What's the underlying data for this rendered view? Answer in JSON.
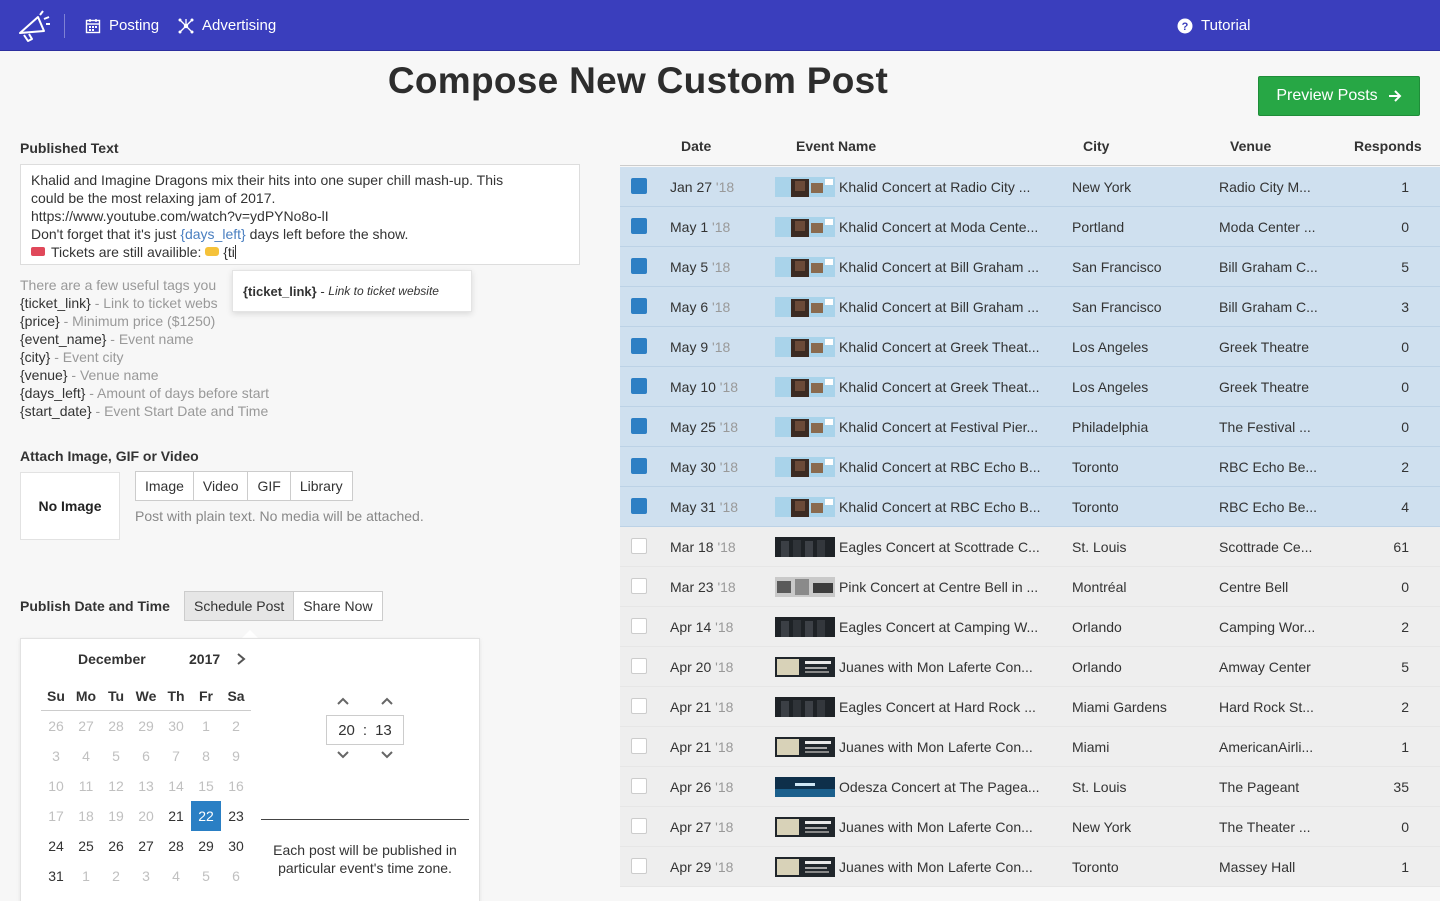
{
  "nav": {
    "posting": "Posting",
    "advertising": "Advertising",
    "tutorial": "Tutorial",
    "bar_color": "#3a3ebd"
  },
  "page": {
    "title": "Compose New Custom Post",
    "preview_button": "Preview Posts"
  },
  "published_text": {
    "label": "Published Text",
    "line1": "Khalid and Imagine Dragons mix their hits into one super chill mash-up. This",
    "line2": "could be the most relaxing jam of 2017.",
    "line3": "https://www.youtube.com/watch?v=ydPYNo8o-lI",
    "line4_pre": "Don't forget that it's just ",
    "line4_tag": "{days_left}",
    "line4_post": " days left before the show.",
    "line5_pre": "Tickets are still availible: ",
    "line5_post": " {ti"
  },
  "autocomplete": {
    "tag": "{ticket_link}",
    "sep": " - ",
    "desc": "Link to ticket website"
  },
  "tags_help": {
    "intro": "There are a few useful tags you",
    "items": [
      {
        "tag": "{ticket_link}",
        "desc": " - Link to ticket webs"
      },
      {
        "tag": "{price}",
        "desc": " - Minimum price ($1250)"
      },
      {
        "tag": "{event_name}",
        "desc": " - Event name"
      },
      {
        "tag": "{city}",
        "desc": " - Event city"
      },
      {
        "tag": "{venue}",
        "desc": " - Venue name"
      },
      {
        "tag": "{days_left}",
        "desc": " - Amount of days before start"
      },
      {
        "tag": "{start_date}",
        "desc": " - Event Start Date and Time"
      }
    ]
  },
  "media": {
    "label": "Attach Image, GIF or Video",
    "no_image": "No Image",
    "buttons": [
      "Image",
      "Video",
      "GIF",
      "Library"
    ],
    "note": "Post with plain text. No media will be attached."
  },
  "schedule": {
    "label": "Publish Date and Time",
    "schedule_button": "Schedule Post",
    "share_button": "Share Now"
  },
  "calendar": {
    "month": "December",
    "year": "2017",
    "weekdays": [
      "Su",
      "Mo",
      "Tu",
      "We",
      "Th",
      "Fr",
      "Sa"
    ],
    "weeks": [
      [
        [
          "26",
          1
        ],
        [
          "27",
          1
        ],
        [
          "28",
          1
        ],
        [
          "29",
          1
        ],
        [
          "30",
          1
        ],
        [
          "1",
          1
        ],
        [
          "2",
          1
        ]
      ],
      [
        [
          "3",
          1
        ],
        [
          "4",
          1
        ],
        [
          "5",
          1
        ],
        [
          "6",
          1
        ],
        [
          "7",
          1
        ],
        [
          "8",
          1
        ],
        [
          "9",
          1
        ]
      ],
      [
        [
          "10",
          1
        ],
        [
          "11",
          1
        ],
        [
          "12",
          1
        ],
        [
          "13",
          1
        ],
        [
          "14",
          1
        ],
        [
          "15",
          1
        ],
        [
          "16",
          1
        ]
      ],
      [
        [
          "17",
          1
        ],
        [
          "18",
          1
        ],
        [
          "19",
          1
        ],
        [
          "20",
          1
        ],
        [
          "21",
          0
        ],
        [
          "22",
          2
        ],
        [
          "23",
          0
        ]
      ],
      [
        [
          "24",
          0
        ],
        [
          "25",
          0
        ],
        [
          "26",
          0
        ],
        [
          "27",
          0
        ],
        [
          "28",
          0
        ],
        [
          "29",
          0
        ],
        [
          "30",
          0
        ]
      ],
      [
        [
          "31",
          0
        ],
        [
          "1",
          1
        ],
        [
          "2",
          1
        ],
        [
          "3",
          1
        ],
        [
          "4",
          1
        ],
        [
          "5",
          1
        ],
        [
          "6",
          1
        ]
      ]
    ],
    "hour": "20",
    "minute": "13",
    "time_sep": ":",
    "tz_note": "Each post will be published in particular event's time zone.",
    "selected_color": "#2a7fc4"
  },
  "table": {
    "headers": {
      "date": "Date",
      "event": "Event Name",
      "city": "City",
      "venue": "Venue",
      "responds": "Responds"
    },
    "rows": [
      {
        "checked": true,
        "date": "Jan 27",
        "yr": " '18",
        "event": "Khalid Concert at Radio City ...",
        "city": "New York",
        "venue": "Radio City M...",
        "responds": "1",
        "thumb": "khalid"
      },
      {
        "checked": true,
        "date": "May 1",
        "yr": " '18",
        "event": "Khalid Concert at Moda Cente...",
        "city": "Portland",
        "venue": "Moda Center ...",
        "responds": "0",
        "thumb": "khalid"
      },
      {
        "checked": true,
        "date": "May 5",
        "yr": " '18",
        "event": "Khalid Concert at Bill Graham ...",
        "city": "San Francisco",
        "venue": "Bill Graham C...",
        "responds": "5",
        "thumb": "khalid"
      },
      {
        "checked": true,
        "date": "May 6",
        "yr": " '18",
        "event": "Khalid Concert at Bill Graham ...",
        "city": "San Francisco",
        "venue": "Bill Graham C...",
        "responds": "3",
        "thumb": "khalid"
      },
      {
        "checked": true,
        "date": "May 9",
        "yr": " '18",
        "event": "Khalid Concert at Greek Theat...",
        "city": "Los Angeles",
        "venue": "Greek Theatre",
        "responds": "0",
        "thumb": "khalid"
      },
      {
        "checked": true,
        "date": "May 10",
        "yr": " '18",
        "event": "Khalid Concert at Greek Theat...",
        "city": "Los Angeles",
        "venue": "Greek Theatre",
        "responds": "0",
        "thumb": "khalid"
      },
      {
        "checked": true,
        "date": "May 25",
        "yr": " '18",
        "event": "Khalid Concert at Festival Pier...",
        "city": "Philadelphia",
        "venue": "The Festival ...",
        "responds": "0",
        "thumb": "khalid"
      },
      {
        "checked": true,
        "date": "May 30",
        "yr": " '18",
        "event": "Khalid Concert at RBC Echo B...",
        "city": "Toronto",
        "venue": "RBC Echo Be...",
        "responds": "2",
        "thumb": "khalid"
      },
      {
        "checked": true,
        "date": "May 31",
        "yr": " '18",
        "event": "Khalid Concert at RBC Echo B...",
        "city": "Toronto",
        "venue": "RBC Echo Be...",
        "responds": "4",
        "thumb": "khalid"
      },
      {
        "checked": false,
        "date": "Mar 18",
        "yr": " '18",
        "event": "Eagles Concert at Scottrade C...",
        "city": "St. Louis",
        "venue": "Scottrade Ce...",
        "responds": "61",
        "thumb": "eagles"
      },
      {
        "checked": false,
        "date": "Mar 23",
        "yr": " '18",
        "event": "Pink Concert at Centre Bell in ...",
        "city": "Montréal",
        "venue": "Centre Bell",
        "responds": "0",
        "thumb": "pink"
      },
      {
        "checked": false,
        "date": "Apr 14",
        "yr": " '18",
        "event": "Eagles Concert at Camping W...",
        "city": "Orlando",
        "venue": "Camping Wor...",
        "responds": "2",
        "thumb": "eagles"
      },
      {
        "checked": false,
        "date": "Apr 20",
        "yr": " '18",
        "event": "Juanes with Mon Laferte Con...",
        "city": "Orlando",
        "venue": "Amway Center",
        "responds": "5",
        "thumb": "juanes"
      },
      {
        "checked": false,
        "date": "Apr 21",
        "yr": " '18",
        "event": "Eagles Concert at Hard Rock ...",
        "city": "Miami Gardens",
        "venue": "Hard Rock St...",
        "responds": "2",
        "thumb": "eagles"
      },
      {
        "checked": false,
        "date": "Apr 21",
        "yr": " '18",
        "event": "Juanes with Mon Laferte Con...",
        "city": "Miami",
        "venue": "AmericanAirli...",
        "responds": "1",
        "thumb": "juanes"
      },
      {
        "checked": false,
        "date": "Apr 26",
        "yr": " '18",
        "event": "Odesza Concert at The Pagea...",
        "city": "St. Louis",
        "venue": "The Pageant",
        "responds": "35",
        "thumb": "odesza"
      },
      {
        "checked": false,
        "date": "Apr 27",
        "yr": " '18",
        "event": "Juanes with Mon Laferte Con...",
        "city": "New York",
        "venue": "The Theater ...",
        "responds": "0",
        "thumb": "juanes"
      },
      {
        "checked": false,
        "date": "Apr 29",
        "yr": " '18",
        "event": "Juanes with Mon Laferte Con...",
        "city": "Toronto",
        "venue": "Massey Hall",
        "responds": "1",
        "thumb": "juanes"
      }
    ],
    "selected_row_color": "#cfe0ef"
  }
}
